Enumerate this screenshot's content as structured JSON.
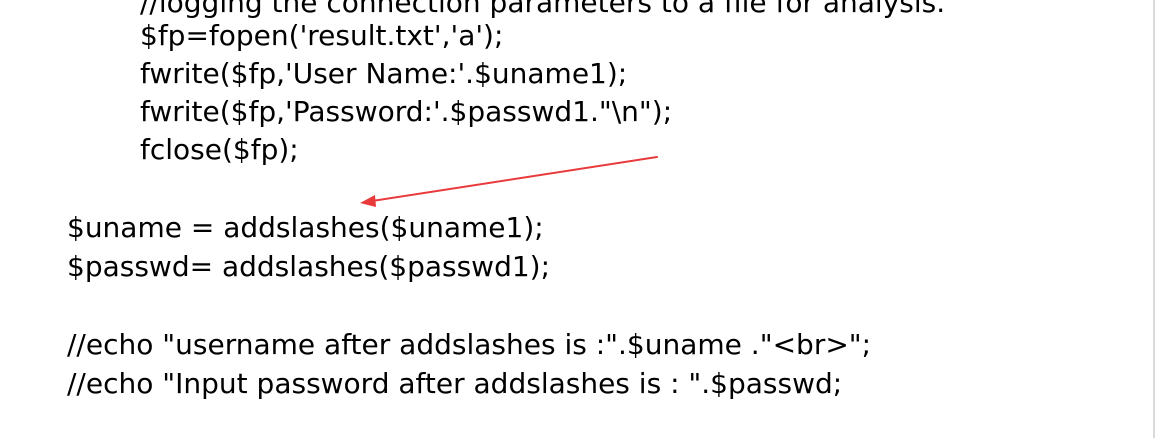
{
  "code_lines": {
    "l0": "//logging the connection parameters to a file for analysis.",
    "l1": "$fp=fopen('result.txt','a');",
    "l2": "fwrite($fp,'User Name:'.$uname1);",
    "l3": "fwrite($fp,'Password:'.$passwd1.\"\\n\");",
    "l4": "fclose($fp);",
    "l5": "$uname = addslashes($uname1);",
    "l6": "$passwd= addslashes($passwd1);",
    "l7": "//echo \"username after addslashes is :\".$uname .\"<br>\";",
    "l8": "//echo \"Input password after addslashes is : \".$passwd;"
  },
  "colors": {
    "background": "#ffffff",
    "text": "#000000",
    "annotation_arrow": "#e8393b",
    "right_border": "#d9d9d9"
  }
}
